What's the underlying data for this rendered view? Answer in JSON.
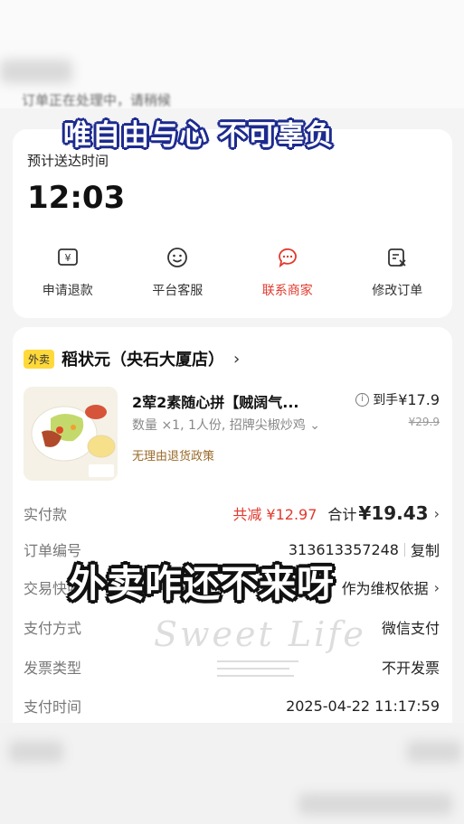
{
  "overlay": {
    "top_caption": "唯自由与心 不可辜负",
    "mid_caption": "外卖咋还不来呀",
    "watermark": "Sweet Life"
  },
  "status": {
    "text": "订单正在处理中，请稍候"
  },
  "delivery": {
    "eta_label": "预计送达时间",
    "eta_time": "12:03",
    "actions": [
      {
        "label": "申请退款",
        "icon": "refund-icon"
      },
      {
        "label": "平台客服",
        "icon": "smile-face-icon"
      },
      {
        "label": "联系商家",
        "icon": "chat-bubble-icon",
        "color": "#e2392d"
      },
      {
        "label": "修改订单",
        "icon": "edit-order-icon"
      }
    ]
  },
  "order": {
    "tag": "外卖",
    "store_name": "稻状元（央石大厦店）",
    "item": {
      "title": "2荤2素随心拼【贼阔气...",
      "spec": "数量 ×1, 1人份, 招牌尖椒炒鸡",
      "policy": "无理由退货政策",
      "net_label": "到手",
      "net_price": "¥17.9",
      "original_price": "¥29.9"
    },
    "rows": [
      {
        "key": "实付款",
        "discount": "共减 ¥12.97",
        "total_label": "合计",
        "total": "¥19.43"
      },
      {
        "key": "订单编号",
        "value": "313613357248",
        "action": "复制"
      },
      {
        "key": "交易快照",
        "value": "作为维权依据"
      },
      {
        "key": "支付方式",
        "value": "微信支付"
      },
      {
        "key": "发票类型",
        "value": "不开发票"
      },
      {
        "key": "支付时间",
        "value": "2025-04-22 11:17:59"
      }
    ]
  },
  "colors": {
    "accent_red": "#e2392d",
    "tag_yellow": "#ffd93a",
    "policy_brown": "#9a6a2a"
  }
}
